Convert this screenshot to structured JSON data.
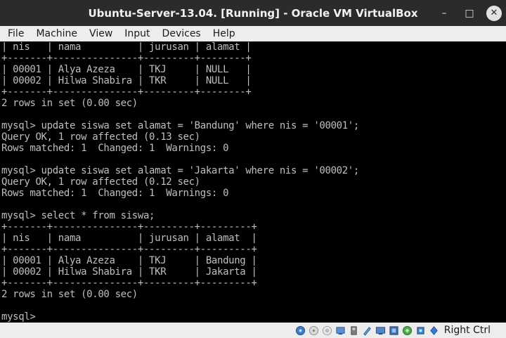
{
  "window": {
    "title": "Ubuntu-Server-13.04. [Running] - Oracle VM VirtualBox",
    "minimize_glyph": "–",
    "maximize_glyph": "□",
    "close_glyph": "✕"
  },
  "menu": {
    "items": [
      {
        "label": "File"
      },
      {
        "label": "Machine"
      },
      {
        "label": "View"
      },
      {
        "label": "Input"
      },
      {
        "label": "Devices"
      },
      {
        "label": "Help"
      }
    ]
  },
  "terminal": {
    "lines": [
      "| nis   | nama          | jurusan | alamat |",
      "+-------+---------------+---------+--------+",
      "| 00001 | Alya Azeza    | TKJ     | NULL   |",
      "| 00002 | Hilwa Shabira | TKR     | NULL   |",
      "+-------+---------------+---------+--------+",
      "2 rows in set (0.00 sec)",
      "",
      "mysql> update siswa set alamat = 'Bandung' where nis = '00001';",
      "Query OK, 1 row affected (0.13 sec)",
      "Rows matched: 1  Changed: 1  Warnings: 0",
      "",
      "mysql> update siswa set alamat = 'Jakarta' where nis = '00002';",
      "Query OK, 1 row affected (0.12 sec)",
      "Rows matched: 1  Changed: 1  Warnings: 0",
      "",
      "mysql> select * from siswa;",
      "+-------+---------------+---------+---------+",
      "| nis   | nama          | jurusan | alamat  |",
      "+-------+---------------+---------+---------+",
      "| 00001 | Alya Azeza    | TKJ     | Bandung |",
      "| 00002 | Hilwa Shabira | TKR     | Jakarta |",
      "+-------+---------------+---------+---------+",
      "2 rows in set (0.00 sec)",
      "",
      "mysql> "
    ]
  },
  "statusbar": {
    "icons": [
      "hard-disk-icon",
      "optical-drive-icon",
      "audio-icon",
      "network-icon",
      "usb-icon",
      "shared-folders-icon",
      "display-icon",
      "video-capture-icon",
      "mouse-integration-icon",
      "cpu-icon",
      "keyboard-capture-icon"
    ],
    "host_key": "Right Ctrl"
  },
  "colors": {
    "titlebar": "#2b2b2b",
    "menubar": "#ededed",
    "terminal_bg": "#000000",
    "terminal_fg": "#bfbfbf"
  }
}
